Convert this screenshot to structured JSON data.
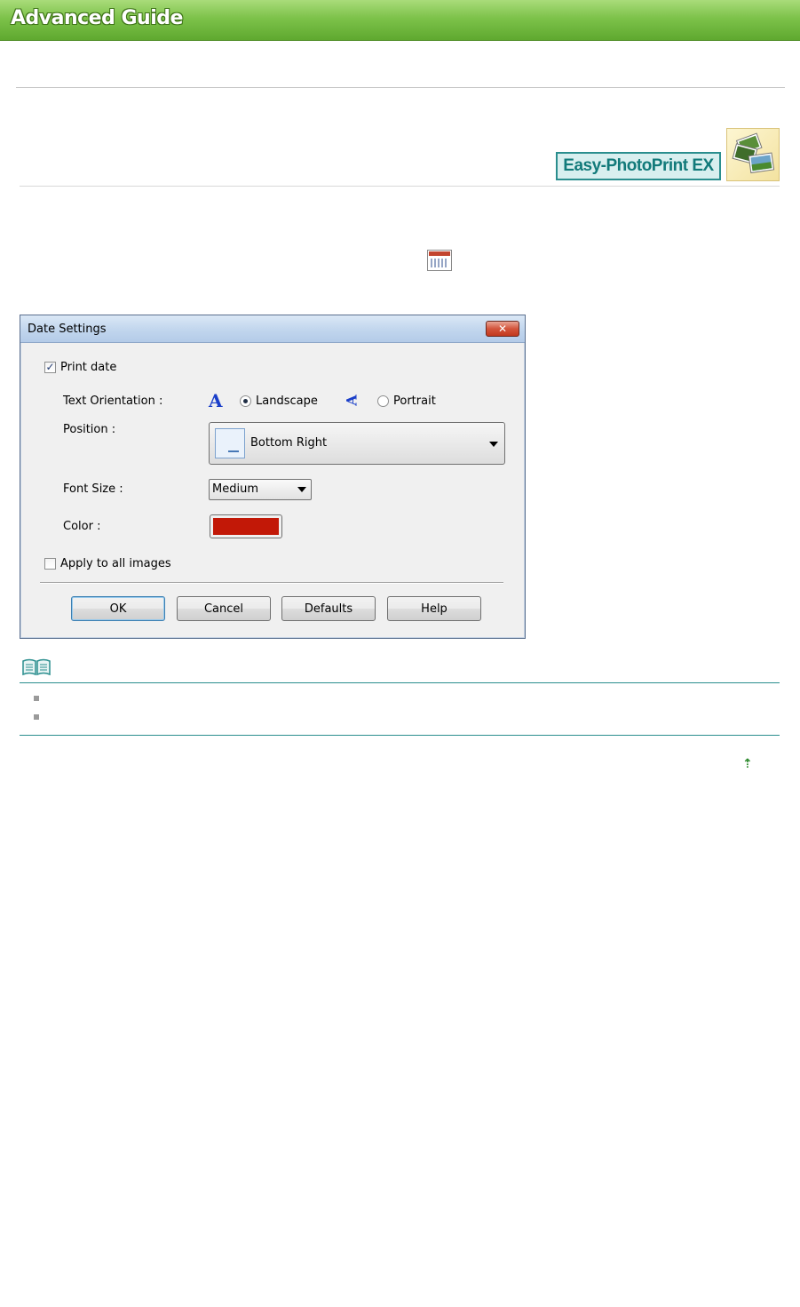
{
  "header": {
    "title": "Advanced Guide",
    "banner_color": "#7dc24a"
  },
  "product": {
    "name": "Easy-PhotoPrint EX",
    "accent": "#127a7a",
    "thumbnail_icon": "photos-stack-icon"
  },
  "inline_icons": {
    "calendar": "calendar-icon"
  },
  "dialog": {
    "title": "Date Settings",
    "close_label": "✕",
    "print_date": {
      "label": "Print date",
      "checked": true
    },
    "text_orientation": {
      "label": "Text Orientation :",
      "options": [
        {
          "label": "Landscape",
          "selected": true,
          "icon": "landscape-a-icon",
          "glyph": "A"
        },
        {
          "label": "Portrait",
          "selected": false,
          "icon": "portrait-a-icon",
          "glyph": "A"
        }
      ]
    },
    "position": {
      "label": "Position :",
      "value": "Bottom Right"
    },
    "font_size": {
      "label": "Font Size :",
      "value": "Medium"
    },
    "color": {
      "label": "Color :",
      "value": "#c21807"
    },
    "apply_all": {
      "label": "Apply to all images",
      "checked": false
    },
    "buttons": {
      "ok": "OK",
      "cancel": "Cancel",
      "defaults": "Defaults",
      "help": "Help"
    }
  },
  "note": {
    "icon": "open-book-icon",
    "bullets": [
      "",
      ""
    ]
  },
  "footer": {
    "top_link_icon": "page-top-arrow-icon",
    "top_link_glyph": "⇡"
  }
}
